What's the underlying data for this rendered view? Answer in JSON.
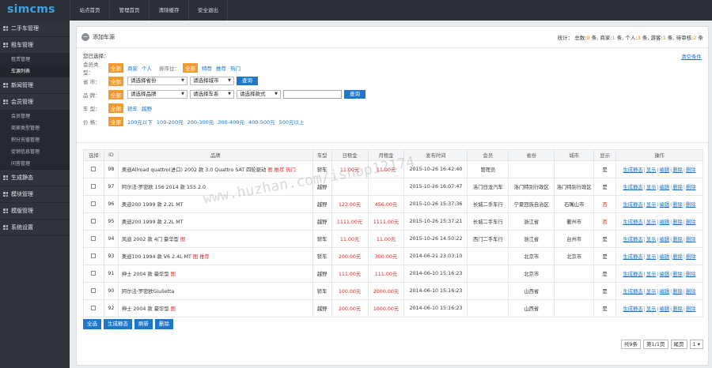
{
  "app": {
    "logo": "simcms"
  },
  "topnav": [
    {
      "label": "站点首页"
    },
    {
      "label": "管理首页"
    },
    {
      "label": "清除缓存"
    },
    {
      "label": "安全退出"
    }
  ],
  "sidebar": {
    "groups": [
      {
        "label": "二手车管理",
        "subs": []
      },
      {
        "label": "租车管理",
        "subs": [
          {
            "label": "租赁管理",
            "active": false
          },
          {
            "label": "车源列表",
            "active": true
          }
        ]
      },
      {
        "label": "新闻管理",
        "subs": []
      },
      {
        "label": "会员管理",
        "subs": [
          {
            "label": "会员管理",
            "active": false
          },
          {
            "label": "商家类型管理",
            "active": false
          },
          {
            "label": "积分充值管理",
            "active": false
          },
          {
            "label": "促销信息管理",
            "active": false
          },
          {
            "label": "问答管理",
            "active": false
          }
        ]
      },
      {
        "label": "生成静态",
        "subs": []
      },
      {
        "label": "模块管理",
        "subs": []
      },
      {
        "label": "模版管理",
        "subs": []
      },
      {
        "label": "系统设置",
        "subs": []
      }
    ]
  },
  "header": {
    "add_label": "添加车源",
    "stats_prefix": "统计：",
    "stats": [
      {
        "label": "总数:",
        "value": "9",
        "unit": "条,"
      },
      {
        "label": "商家:",
        "value": "1",
        "unit": "条,"
      },
      {
        "label": "个人:",
        "value": "3",
        "unit": "条,"
      },
      {
        "label": "游客:",
        "value": "1",
        "unit": "条,"
      },
      {
        "label": "待审核:",
        "value": "2",
        "unit": "条"
      }
    ]
  },
  "filter": {
    "title": "您已选择：",
    "clear_label": "清空条件",
    "member_type": {
      "label": "会员类型：",
      "all": "全部",
      "options": [
        "商家",
        "个人"
      ],
      "sort_label": "排序位：",
      "sort_all": "全部",
      "sort_options": [
        "特荐",
        "推荐",
        "热门"
      ]
    },
    "region": {
      "label": "省 市：",
      "all": "全部",
      "province_placeholder": "请选择省份",
      "city_placeholder": "请选择城市",
      "button": "查询"
    },
    "brand": {
      "label": "品 牌：",
      "all": "全部",
      "brand_placeholder": "请选择品牌",
      "series_placeholder": "请选择车系",
      "model_placeholder": "请选择款式",
      "keyword_value": "",
      "button": "查询"
    },
    "car_type": {
      "label": "车 型：",
      "all": "全部",
      "options": [
        "轿车",
        "越野"
      ]
    },
    "price": {
      "label": "价 格：",
      "all": "全部",
      "options": [
        "100元以下",
        "100-200元",
        "200-300元",
        "300-400元",
        "400-500元",
        "500元以上"
      ]
    }
  },
  "table": {
    "headers": [
      "选择",
      "ID",
      "品牌",
      "车型",
      "日租金",
      "月租金",
      "发布时间",
      "会员",
      "省份",
      "城市",
      "显示",
      "操作"
    ],
    "rows": [
      {
        "id": "98",
        "brand": "奥迪Allroad quattro(进口) 2002 款 3.0 Quattro SAT 四轮驱动",
        "flags": "图 推荐 热门",
        "type": "轿车",
        "day": "11.00元",
        "month": "11.00元",
        "time": "2015-10-26 16:42:40",
        "member": "管理员",
        "province": "",
        "city": "",
        "show": "是",
        "show_red": false
      },
      {
        "id": "97",
        "brand": "阿尔法·罗密欧 156 2014 款 155 2.0",
        "flags": "",
        "type": "越野",
        "day": "",
        "month": "",
        "time": "2015-10-26 16:07:47",
        "member": "洛门日龙汽车",
        "province": "洛门特别行政区",
        "city": "洛门特别行政区",
        "show": "是",
        "show_red": false
      },
      {
        "id": "96",
        "brand": "奥迪200 1999 款 2.2L MT",
        "flags": "",
        "type": "越野",
        "day": "123.00元",
        "month": "456.00元",
        "time": "2015-10-26 15:37:36",
        "member": "长城二手车行",
        "province": "宁夏回族自治区",
        "city": "石嘴山市",
        "show": "否",
        "show_red": true
      },
      {
        "id": "95",
        "brand": "奥迪200 1999 款 2.2L MT",
        "flags": "",
        "type": "越野",
        "day": "1111.00元",
        "month": "1111.00元",
        "time": "2015-10-26 15:37:21",
        "member": "长城二手车行",
        "province": "浙江省",
        "city": "衢州市",
        "show": "否",
        "show_red": true
      },
      {
        "id": "94",
        "brand": "风迪 2002 款 4门 豪华型",
        "flags": "图",
        "type": "轿车",
        "day": "11.00元",
        "month": "11.00元",
        "time": "2015-10-26 14:50:22",
        "member": "西门二手车行",
        "province": "浙江省",
        "city": "台州市",
        "show": "是",
        "show_red": false
      },
      {
        "id": "93",
        "brand": "奥迪100 1994 款 V6 2.4L MT",
        "flags": "图 推荐",
        "type": "轿车",
        "day": "200.00元",
        "month": "300.00元",
        "time": "2014-06-21 23:03:10",
        "member": "",
        "province": "北京市",
        "city": "北京市",
        "show": "是",
        "show_red": false
      },
      {
        "id": "91",
        "brand": "绅士 2004 款 豪华型",
        "flags": "图",
        "type": "越野",
        "day": "111.00元",
        "month": "111.00元",
        "time": "2014-06-10 15:16:23",
        "member": "",
        "province": "北京市",
        "city": "",
        "show": "是",
        "show_red": false
      },
      {
        "id": "90",
        "brand": "阿尔法·罗密欧Giulietta",
        "flags": "",
        "type": "轿车",
        "day": "100.00元",
        "month": "2000.00元",
        "time": "2014-06-10 15:16:23",
        "member": "",
        "province": "山西省",
        "city": "",
        "show": "是",
        "show_red": false
      },
      {
        "id": "92",
        "brand": "绅士 2004 款 豪华型",
        "flags": "图",
        "type": "越野",
        "day": "200.00元",
        "month": "1000.00元",
        "time": "2014-06-10 15:16:23",
        "member": "",
        "province": "山西省",
        "city": "",
        "show": "是",
        "show_red": false
      }
    ],
    "ops": [
      "生成静态",
      "显示",
      "编辑",
      "删除",
      "删除"
    ]
  },
  "bottom_buttons": [
    "全选",
    "生成静态",
    "刷新",
    "删除"
  ],
  "pager": {
    "total": "共9条",
    "page": "第1/1页",
    "first": "尾页",
    "select": "1"
  },
  "watermark": "www.huzhan.com/ishop12174"
}
